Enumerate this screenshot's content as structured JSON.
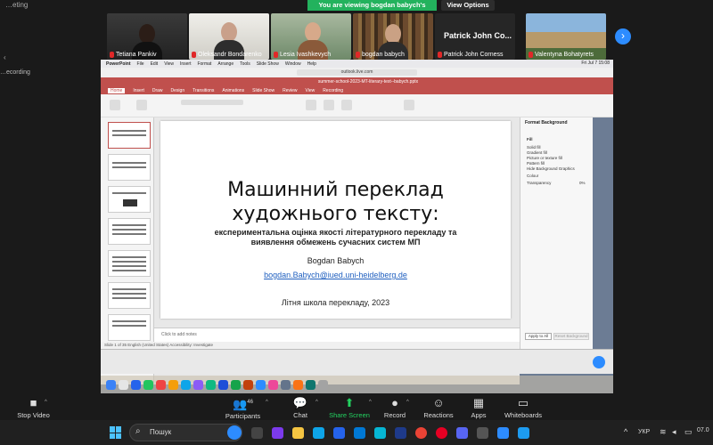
{
  "window": {
    "title": "…eting"
  },
  "banner": {
    "sharing": "You are viewing bogdan babych's screen",
    "view_options": "View Options"
  },
  "sidebar": {
    "recording_label": "…ecording"
  },
  "participants_tiles": [
    {
      "name": "Tetiana Pankiv",
      "muted": true
    },
    {
      "name": "Oleksandr Bondarenko",
      "muted": true
    },
    {
      "name": "Lesia Ivashkevych",
      "muted": true
    },
    {
      "name": "bogdan babych",
      "muted": true
    },
    {
      "name": "Patrick John Corness",
      "muted": true,
      "big_label": "Patrick John Co..."
    },
    {
      "name": "Valentyna Bohatyrets",
      "muted": true
    }
  ],
  "shared_screen": {
    "mac_menu": [
      "PowerPoint",
      "File",
      "Edit",
      "View",
      "Insert",
      "Format",
      "Arrange",
      "Tools",
      "Slide Show",
      "Window",
      "Help"
    ],
    "mac_clock": "Fri Jul 7 15:08",
    "url": "outlook.live.com",
    "doc_title": "summer-school-2023-MT-literary-text--babych.pptx",
    "ppt_tabs": [
      "Home",
      "Insert",
      "Draw",
      "Design",
      "Transitions",
      "Animations",
      "Slide Show",
      "Review",
      "View",
      "Recording"
    ],
    "slide": {
      "title_line1": "Машинний переклад",
      "title_line2": "художнього тексту:",
      "subtitle": "експериментальна оцінка якості літературного перекладу та виявлення обмежень сучасних систем МП",
      "author": "Bogdan Babych",
      "email": "bogdan.Babych@iued.uni-heidelberg.de",
      "footer": "Літня школа перекладу, 2023"
    },
    "notes_placeholder": "Click to add notes",
    "status": "Slide 1 of 35   English (United States)   Accessibility: Investigate",
    "format_pane": {
      "title": "Format Background",
      "section": "Fill",
      "options": [
        "Solid fill",
        "Gradient fill",
        "Picture or texture fill",
        "Pattern fill",
        "Hide Background Graphics"
      ],
      "colour_label": "Colour",
      "transparency_label": "Transparency",
      "transparency_value": "0%",
      "apply_all": "Apply to All",
      "reset": "Reset Background"
    }
  },
  "toolbar": {
    "stop_video": "Stop Video",
    "participants": "Participants",
    "participants_count": "46",
    "chat": "Chat",
    "share_screen": "Share Screen",
    "record": "Record",
    "reactions": "Reactions",
    "apps": "Apps",
    "whiteboards": "Whiteboards"
  },
  "taskbar": {
    "search_placeholder": "Пошук",
    "language": "УКР",
    "clock": "07.0"
  },
  "colors": {
    "accent_green": "#23b25d",
    "zoom_blue": "#2d8cff",
    "ppt_red": "#c0504d"
  }
}
